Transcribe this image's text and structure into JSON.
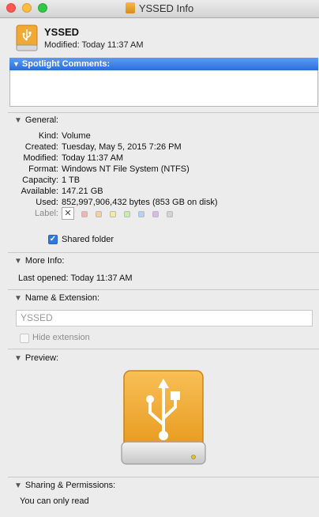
{
  "window": {
    "title": "YSSED Info"
  },
  "header": {
    "name": "YSSED",
    "modified": "Modified: Today 11:37 AM"
  },
  "spotlight": {
    "label": "Spotlight Comments:",
    "value": ""
  },
  "general": {
    "title": "General:",
    "rows": [
      {
        "label": "Kind:",
        "value": "Volume"
      },
      {
        "label": "Created:",
        "value": "Tuesday, May 5, 2015 7:26 PM"
      },
      {
        "label": "Modified:",
        "value": "Today 11:37 AM"
      },
      {
        "label": "Format:",
        "value": "Windows NT File System (NTFS)"
      },
      {
        "label": "Capacity:",
        "value": "1 TB"
      },
      {
        "label": "Available:",
        "value": "147.21 GB"
      },
      {
        "label": "Used:",
        "value": "852,997,906,432 bytes (853 GB on disk)"
      }
    ],
    "label_caption": "Label:",
    "label_none_glyph": "✕",
    "label_colors": [
      "#f3b4b0",
      "#f6cf9d",
      "#f3ea9e",
      "#c9ecaa",
      "#b3d2f5",
      "#dab8ea",
      "#d3d3d3"
    ],
    "shared_folder": {
      "label": "Shared folder",
      "checked": true,
      "glyph": "✓"
    }
  },
  "more_info": {
    "title": "More Info:",
    "last_opened": "Last opened: Today 11:37 AM"
  },
  "name_extension": {
    "title": "Name & Extension:",
    "name_value": "YSSED",
    "hide_extension": {
      "label": "Hide extension",
      "checked": false
    }
  },
  "preview": {
    "title": "Preview:",
    "icon": "usb-drive-icon",
    "color": "#f0a935"
  },
  "sharing": {
    "title": "Sharing & Permissions:",
    "status": "You can only read"
  },
  "icons": {
    "disclosure": "▼"
  }
}
